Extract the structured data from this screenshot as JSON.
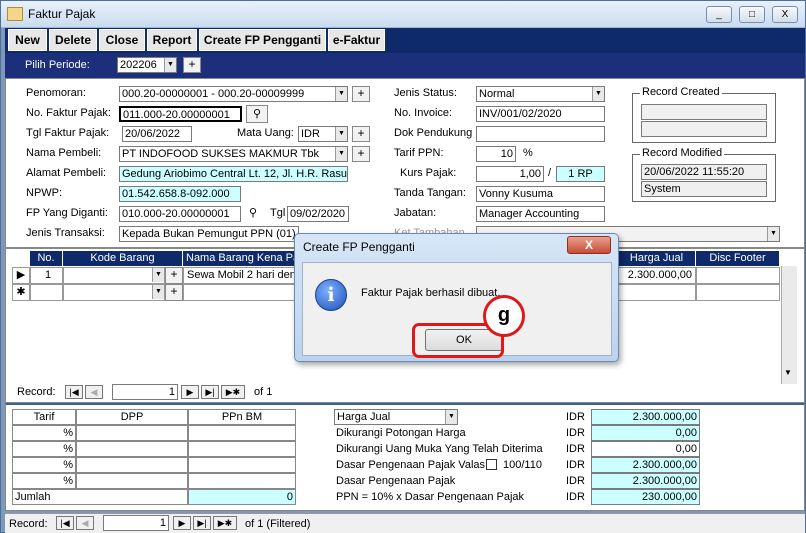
{
  "window": {
    "title": "Faktur Pajak",
    "minimize": "_",
    "maximize": "□",
    "close": "X"
  },
  "toolbar": {
    "new": "New",
    "delete": "Delete",
    "close": "Close",
    "report": "Report",
    "create_fp": "Create FP Pengganti",
    "efaktur": "e-Faktur"
  },
  "periode": {
    "label": "Pilih Periode:",
    "value": "202206",
    "plus": "+"
  },
  "form": {
    "penomoran_label": "Penomoran:",
    "penomoran_value": "000.20-00000001 - 000.20-00009999",
    "no_faktur_label": "No. Faktur Pajak:",
    "no_faktur_value": "011.000-20.00000001",
    "tgl_faktur_label": "Tgl Faktur Pajak:",
    "tgl_faktur_value": "20/06/2022",
    "mata_uang_label": "Mata Uang:",
    "mata_uang_value": "IDR",
    "nama_pembeli_label": "Nama Pembeli:",
    "nama_pembeli_value": "PT INDOFOOD SUKSES MAKMUR Tbk",
    "alamat_label": "Alamat Pembeli:",
    "alamat_value": "Gedung Ariobimo Central Lt. 12, Jl. H.R. Rasuna",
    "npwp_label": "NPWP:",
    "npwp_value": "01.542.658.8-092.000",
    "fp_diganti_label": "FP Yang Diganti:",
    "fp_diganti_value": "010.000-20.00000001",
    "tgl_label": "Tgl",
    "tgl_value": "09/02/2020",
    "jenis_transaksi_label": "Jenis Transaksi:",
    "jenis_transaksi_value": "Kepada Bukan Pemungut PPN (01)",
    "jenis_status_label": "Jenis Status:",
    "jenis_status_value": "Normal",
    "no_invoice_label": "No. Invoice:",
    "no_invoice_value": "INV/001/02/2020",
    "dok_pendukung_label": "Dok Pendukung",
    "tarif_ppn_label": "Tarif PPN:",
    "tarif_ppn_value": "10",
    "percent": "%",
    "kurs_label": "Kurs Pajak:",
    "kurs_value": "1,00",
    "slash": "/",
    "kurs_rp": "1 RP",
    "tanda_tangan_label": "Tanda Tangan:",
    "tanda_tangan_value": "Vonny Kusuma",
    "jabatan_label": "Jabatan:",
    "jabatan_value": "Manager Accounting",
    "ket_tambahan_label": "Ket Tambahan",
    "record_created_title": "Record Created",
    "record_modified_title": "Record Modified",
    "record_modified_date": "20/06/2022 11:55:20",
    "record_modified_user": "System",
    "plus": "+"
  },
  "grid": {
    "headers": [
      "No.",
      "Kode Barang",
      "Nama Barang Kena Pa",
      "Harga Jual",
      "Disc Footer"
    ],
    "row1": {
      "selector": "▶",
      "no": "1",
      "nama": "Sewa Mobil 2 hari deng",
      "harga": "2.300.000,00"
    },
    "row_new": {
      "selector": "✱"
    },
    "record_label": "Record:",
    "record_value": "1",
    "record_of": "of 1"
  },
  "dialog": {
    "title": "Create FP Pengganti",
    "message": "Faktur Pajak berhasil dibuat.",
    "ok": "OK",
    "close": "X",
    "info_icon": "i"
  },
  "annotation": {
    "step": "g"
  },
  "summary": {
    "tarif_header": "Tarif",
    "dpp_header": "DPP",
    "ppnbm_header": "PPn BM",
    "percent": "%",
    "jumlah_label": "Jumlah",
    "jumlah_value": "0",
    "harga_jual_select": "Harga Jual",
    "lines": [
      {
        "label": "Dikurangi Potongan Harga",
        "cur": "IDR",
        "value": "0,00"
      },
      {
        "label": "Dikurangi Uang Muka Yang Telah Diterima",
        "cur": "IDR",
        "value": "0,00"
      },
      {
        "label": "Dasar Pengenaan Pajak Valas",
        "extra": "100/110",
        "cur": "IDR",
        "value": "2.300.000,00"
      },
      {
        "label": "Dasar Pengenaan Pajak",
        "cur": "IDR",
        "value": "2.300.000,00"
      },
      {
        "label": "PPN = 10% x  Dasar Pengenaan Pajak",
        "cur": "IDR",
        "value": "230.000,00"
      }
    ],
    "harga_jual_cur": "IDR",
    "harga_jual_value": "2.300.000,00"
  },
  "recordbar": {
    "label": "Record:",
    "value": "1",
    "of": "of  1 (Filtered)"
  }
}
